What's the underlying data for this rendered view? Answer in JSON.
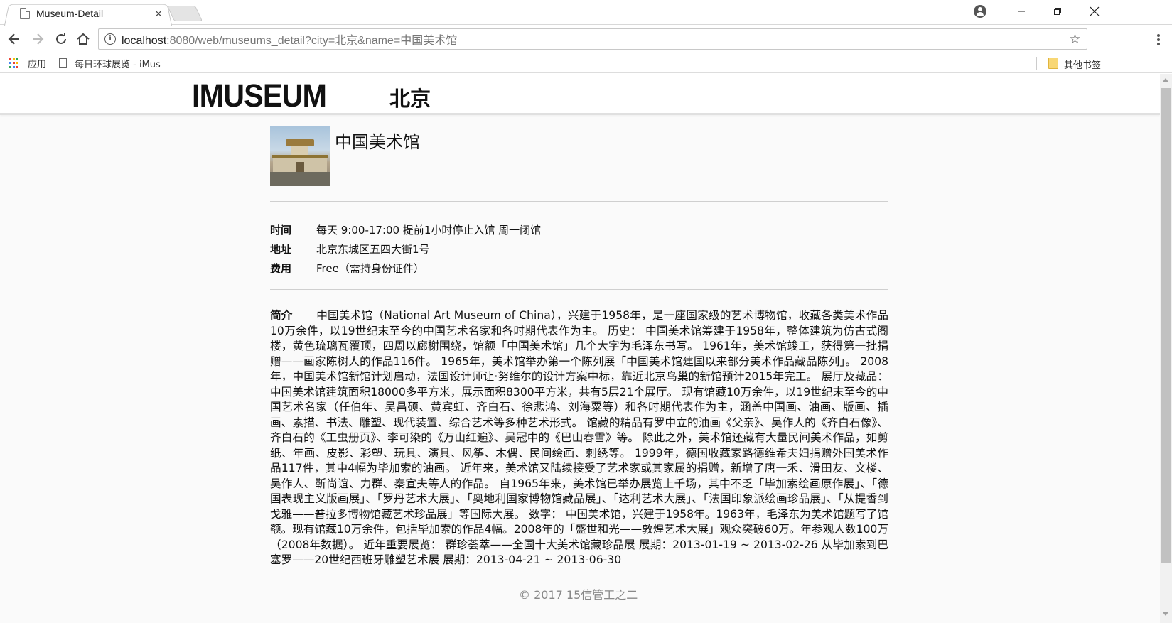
{
  "browser": {
    "tab_title": "Museum-Detail",
    "tab_close": "×",
    "url_host": "localhost",
    "url_rest": ":8080/web/museums_detail?city=北京&name=中国美术馆",
    "bookmarks": {
      "apps_label": "应用",
      "page_label": "每日环球展览 - iMus",
      "other_label": "其他书签"
    }
  },
  "site": {
    "logo": "IMUSEUM",
    "city": "北京"
  },
  "museum": {
    "name": "中国美术馆",
    "time_label": "时间",
    "time_value": "每天 9:00-17:00 提前1小时停止入馆 周一闭馆",
    "address_label": "地址",
    "address_value": "北京东城区五四大街1号",
    "fee_label": "费用",
    "fee_value": "Free（需持身份证件）",
    "intro_label": "简介",
    "intro_text": "中国美术馆（National Art Museum of China），兴建于1958年，是一座国家级的艺术博物馆，收藏各类美术作品10万余件，以19世纪末至今的中国艺术名家和各时期代表作为主。 历史： 中国美术馆筹建于1958年，整体建筑为仿古式阁楼，黄色琉璃瓦覆顶，四周以廊榭围绕，馆额「中国美术馆」几个大字为毛泽东书写。 1961年，美术馆竣工，获得第一批捐赠——画家陈树人的作品116件。 1965年，美术馆举办第一个陈列展「中国美术馆建国以来部分美术作品藏品陈列」。 2008年，中国美术馆新馆计划启动，法国设计师让·努维尔的设计方案中标，靠近北京鸟巢的新馆预计2015年完工。 展厅及藏品： 中国美术馆建筑面积18000多平方米，展示面积8300平方米，共有5层21个展厅。 现有馆藏10万余件，以19世纪末至今的中国艺术名家（任伯年、吴昌硕、黄宾虹、齐白石、徐悲鸿、刘海粟等）和各时期代表作为主，涵盖中国画、油画、版画、插画、素描、书法、雕塑、现代装置、综合艺术等多种艺术形式。 馆藏的精品有罗中立的油画《父亲》、吴作人的《齐白石像》、齐白石的《工虫册页》、李可染的《万山红遍》、吴冠中的《巴山春雪》等。 除此之外，美术馆还藏有大量民间美术作品，如剪纸、年画、皮影、彩塑、玩具、演具、风筝、木偶、民间绘画、刺绣等。 1999年，德国收藏家路德维希夫妇捐赠外国美术作品117件，其中4幅为毕加索的油画。 近年来，美术馆又陆续接受了艺术家或其家属的捐赠，新增了唐一禾、滑田友、文楼、吴作人、靳尚谊、力群、秦宣夫等人的作品。 自1965年来，美术馆已举办展览上千场，其中不乏「毕加索绘画原作展」、「德国表现主义版画展」、「罗丹艺术大展」、「奥地利国家博物馆藏品展」、「达利艺术大展」、「法国印象派绘画珍品展」、「从提香到戈雅——普拉多博物馆藏艺术珍品展」等国际大展。 数字： 中国美术馆，兴建于1958年。1963年，毛泽东为美术馆题写了馆额。现有馆藏10万余件，包括毕加索的作品4幅。2008年的「盛世和光——敦煌艺术大展」观众突破60万。年参观人数100万（2008年数据）。 近年重要展览： 群珍荟萃——全国十大美术馆藏珍品展 展期：2013-01-19 ~ 2013-02-26 从毕加索到巴塞罗——20世纪西班牙雕塑艺术展 展期：2013-04-21 ~ 2013-06-30"
  },
  "footer": {
    "text": "© 2017 15信管工之二"
  },
  "icons": {
    "back": "arrow-left-icon",
    "forward": "arrow-right-icon",
    "reload": "reload-icon",
    "home": "home-icon",
    "info": "info-icon",
    "star": "star-icon",
    "menu": "menu-dots-icon",
    "profile": "profile-icon",
    "apps": "apps-grid-icon",
    "folder": "folder-icon"
  }
}
